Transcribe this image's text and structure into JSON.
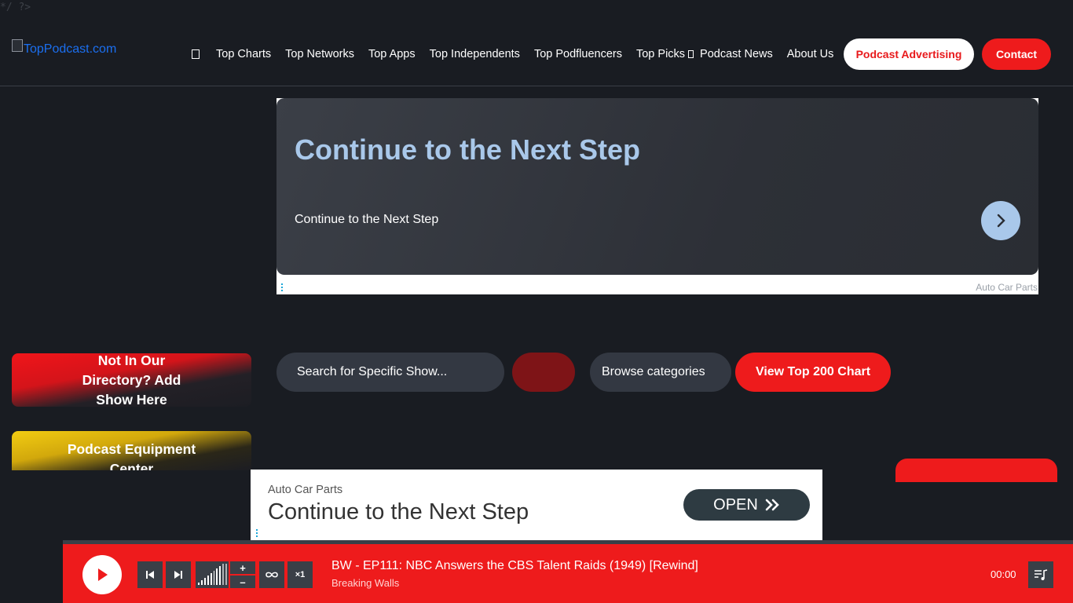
{
  "stray_text": "*/ ?>",
  "header": {
    "logo_alt": "TopPodcast.com",
    "nav": [
      "Top Charts",
      "Top Networks",
      "Top Apps",
      "Top Independents",
      "Top Podfluencers",
      "Top Picks",
      "Podcast News",
      "About Us"
    ],
    "advertising_label": "Podcast Advertising",
    "contact_label": "Contact"
  },
  "top_ad": {
    "headline": "Continue to the Next Step",
    "subtext": "Continue to the Next Step",
    "sponsor": "Auto Car Parts"
  },
  "sidebar": {
    "add_show": "Not In Our Directory? Add Show Here",
    "equipment": "Podcast Equipment Center"
  },
  "search": {
    "placeholder": "Search for Specific Show...",
    "browse_label": "Browse categories",
    "top200_label": "View Top 200 Chart"
  },
  "bottom_ad": {
    "sponsor": "Auto Car Parts",
    "headline": "Continue to the Next Step",
    "cta": "OPEN"
  },
  "player": {
    "episode_title": "BW - EP111: NBC Answers the CBS Talent Raids (1949) [Rewind]",
    "show_name": "Breaking Walls",
    "time": "00:00",
    "speed": "×1",
    "volume_up": "+",
    "volume_down": "–",
    "colors": {
      "accent": "#ee1b1c",
      "control_bg": "#3a3f47"
    }
  }
}
